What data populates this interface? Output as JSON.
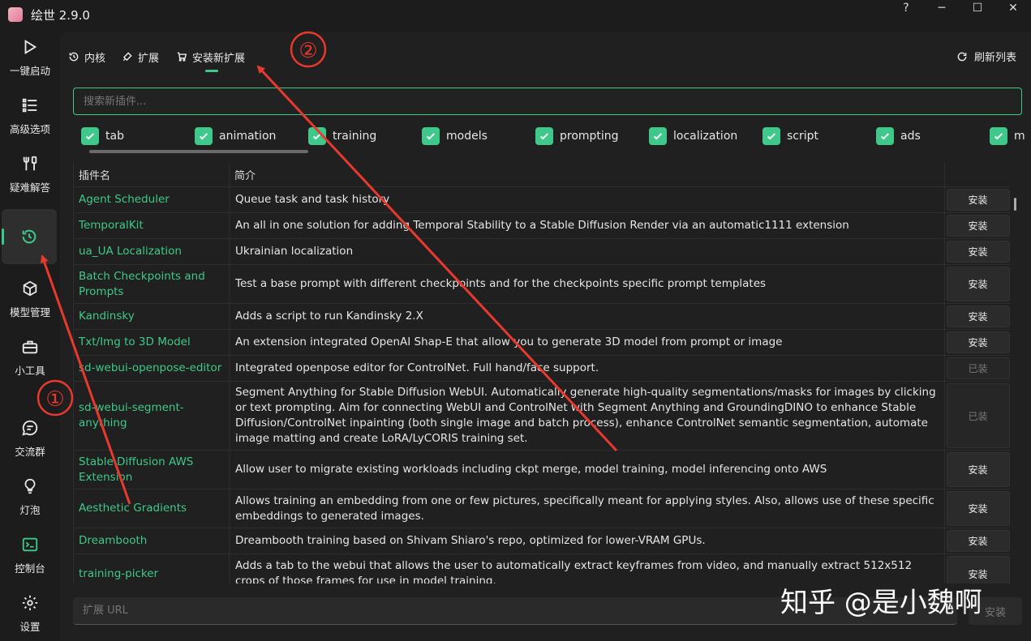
{
  "window": {
    "title": "绘世 2.9.0",
    "help": "?",
    "minimize": "─",
    "maximize": "☐",
    "close": "✕"
  },
  "sidebar": {
    "items": [
      {
        "label": "一键启动",
        "icon": "play-icon"
      },
      {
        "label": "高级选项",
        "icon": "list-icon"
      },
      {
        "label": "疑难解答",
        "icon": "tools-icon"
      },
      {
        "label": "",
        "icon": "history-icon",
        "active": true
      },
      {
        "label": "模型管理",
        "icon": "cube-icon"
      },
      {
        "label": "小工具",
        "icon": "toolbox-icon"
      },
      {
        "label": "交流群",
        "icon": "chat-icon"
      },
      {
        "label": "灯泡",
        "icon": "bulb-icon"
      },
      {
        "label": "控制台",
        "icon": "terminal-icon"
      },
      {
        "label": "设置",
        "icon": "gear-icon"
      }
    ]
  },
  "tabs": {
    "core": "内核",
    "extensions": "扩展",
    "install_new": "安装新扩展",
    "active": "install_new"
  },
  "refresh_label": "刷新列表",
  "search": {
    "placeholder": "搜索新插件...",
    "value": ""
  },
  "tags": [
    "tab",
    "animation",
    "training",
    "models",
    "prompting",
    "localization",
    "script",
    "ads",
    "m"
  ],
  "table": {
    "headers": {
      "name": "插件名",
      "description": "简介",
      "action": ""
    },
    "rows": [
      {
        "name": "Agent Scheduler",
        "description": "Queue task and task history",
        "action": "安装",
        "installed": false
      },
      {
        "name": "TemporalKit",
        "description": "An all in one solution for adding Temporal Stability to a Stable Diffusion Render via an automatic1111 extension",
        "action": "安装",
        "installed": false
      },
      {
        "name": "ua_UA Localization",
        "description": "Ukrainian localization",
        "action": "安装",
        "installed": false
      },
      {
        "name": "Batch Checkpoints and Prompts",
        "description": "Test a base prompt with different checkpoints and for the checkpoints specific prompt templates",
        "action": "安装",
        "installed": false
      },
      {
        "name": "Kandinsky",
        "description": "Adds a script to run Kandinsky 2.X",
        "action": "安装",
        "installed": false
      },
      {
        "name": "Txt/Img to 3D Model",
        "description": "An extension integrated OpenAI Shap-E that allow you to generate 3D model from prompt or image",
        "action": "安装",
        "installed": false
      },
      {
        "name": "sd-webui-openpose-editor",
        "description": "Integrated openpose editor for ControlNet. Full hand/face support.",
        "action": "已装",
        "installed": true
      },
      {
        "name": "sd-webui-segment-anything",
        "description": "Segment Anything for Stable Diffusion WebUI. Automatically generate high-quality segmentations/masks for images by clicking or text prompting. Aim for connecting WebUI and ControlNet with Segment Anything and GroundingDINO to enhance Stable Diffusion/ControlNet inpainting (both single image and batch process), enhance ControlNet semantic segmentation, automate image matting and create LoRA/LyCORIS training set.",
        "action": "已装",
        "installed": true
      },
      {
        "name": "Stable Diffusion AWS Extension",
        "description": "Allow user to migrate existing workloads including ckpt merge, model training, model inferencing onto AWS",
        "action": "安装",
        "installed": false
      },
      {
        "name": "Aesthetic Gradients",
        "description": "Allows training an embedding from one or few pictures, specifically meant for applying styles. Also, allows use of these specific embeddings to generated images.",
        "action": "安装",
        "installed": false
      },
      {
        "name": "Dreambooth",
        "description": "Dreambooth training based on Shivam Shiaro's repo, optimized for lower-VRAM GPUs.",
        "action": "安装",
        "installed": false
      },
      {
        "name": "training-picker",
        "description": "Adds a tab to the webui that allows the user to automatically extract keyframes from video, and manually extract 512x512 crops of those frames for use in model training.",
        "action": "安装",
        "installed": false
      }
    ]
  },
  "url_input": {
    "placeholder": "扩展 URL",
    "value": ""
  },
  "url_install_label": "安装",
  "annotations": {
    "marker1": "①",
    "marker2": "②",
    "color": "#e8392e"
  },
  "watermark": "知乎 @是小魏啊",
  "colors": {
    "accent": "#3ec98a",
    "background": "#202020",
    "sidebar": "#1c1c1c",
    "annotation": "#e8392e"
  }
}
